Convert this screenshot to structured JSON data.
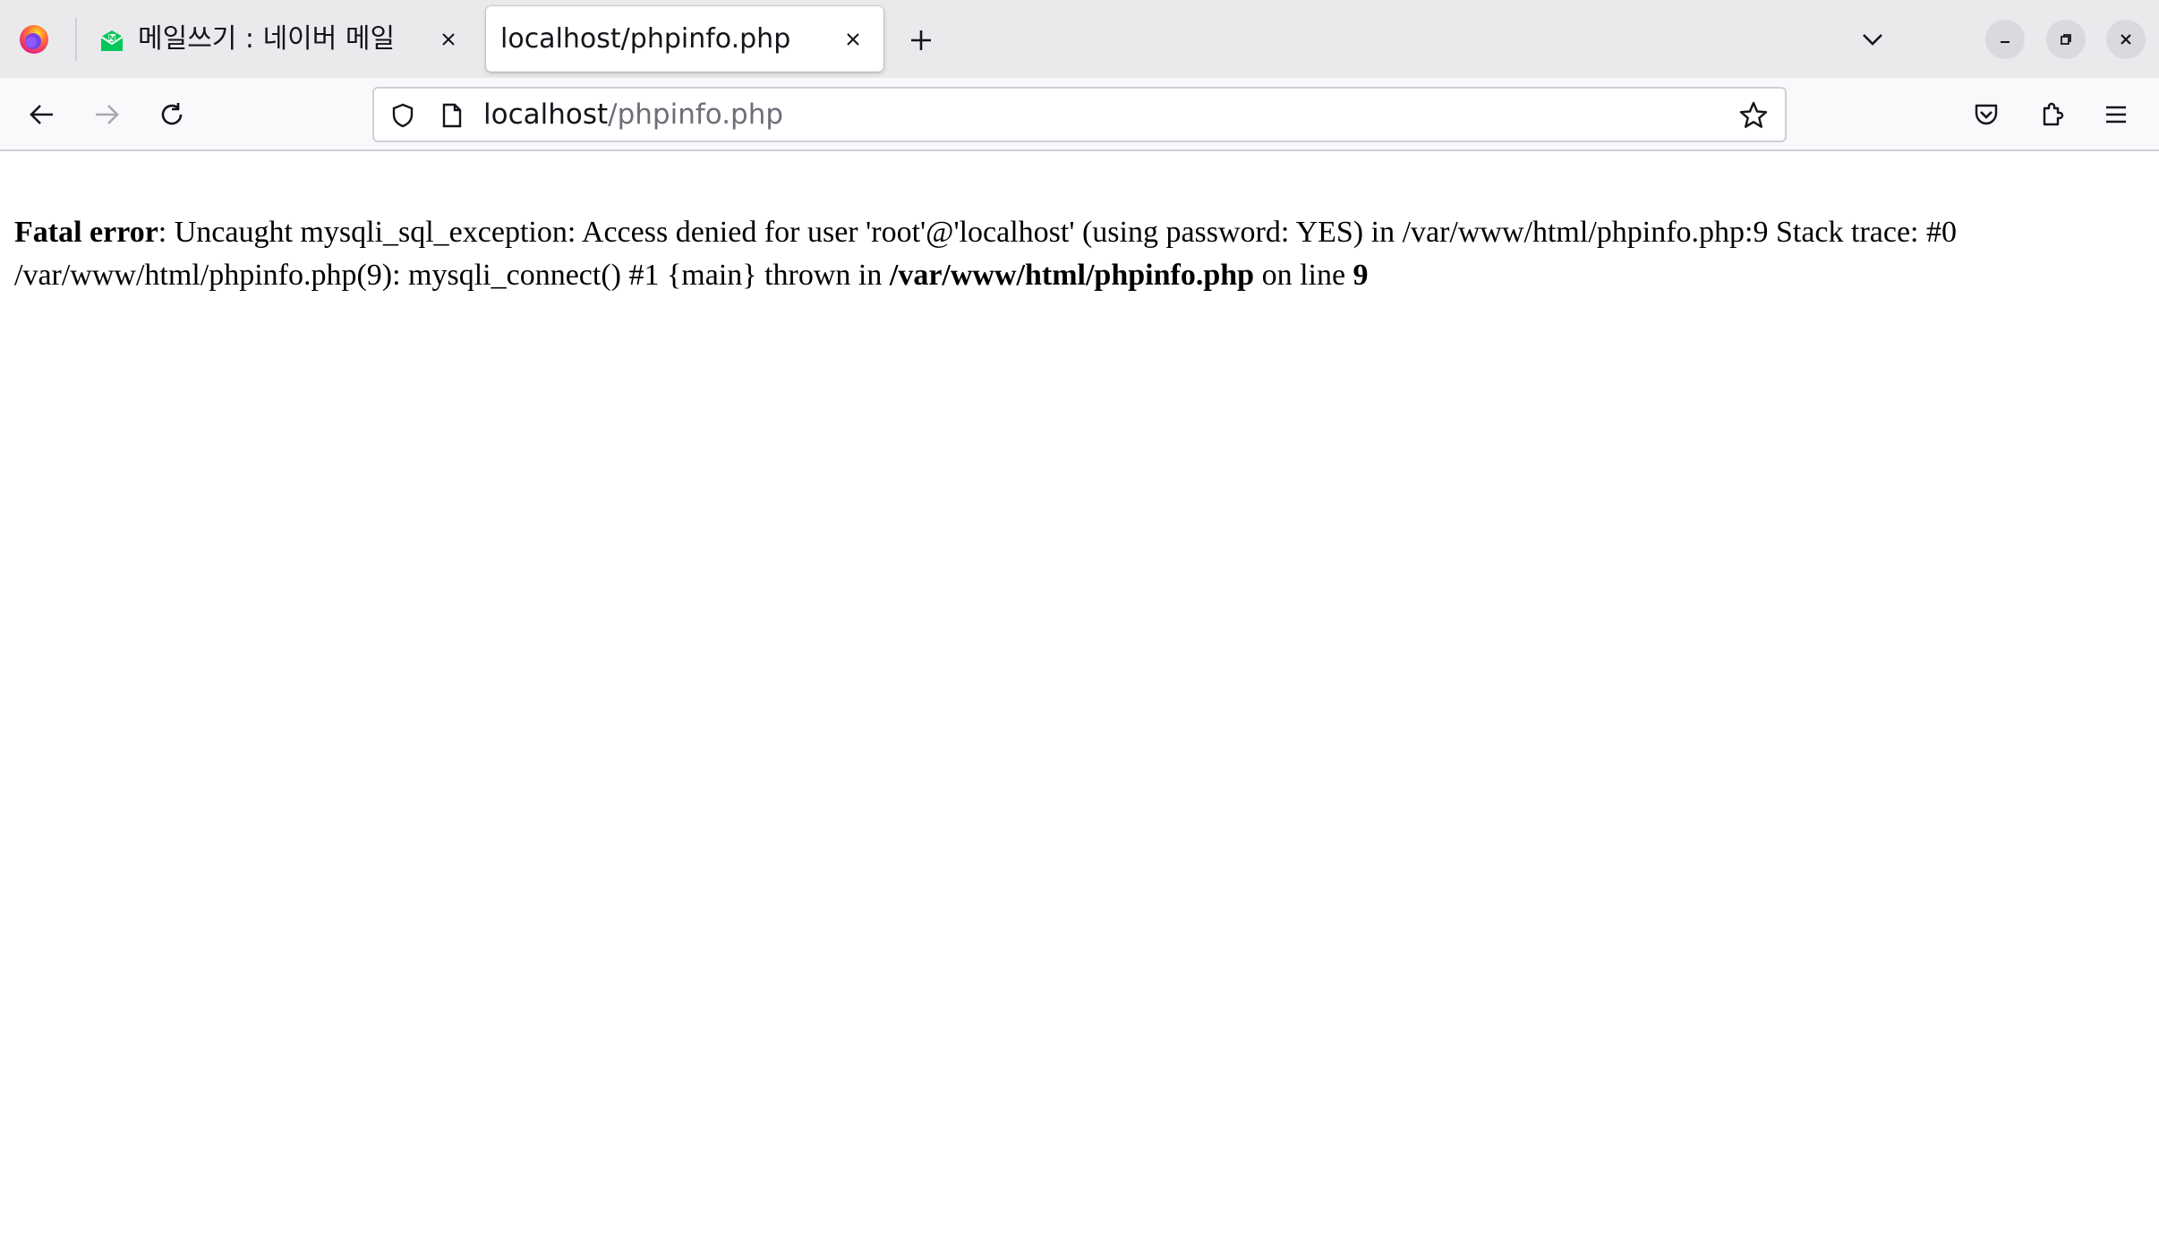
{
  "browser": {
    "tabs": [
      {
        "title": "메일쓰기 : 네이버 메일",
        "active": false,
        "favicon": "naver-mail-icon"
      },
      {
        "title": "localhost/phpinfo.php",
        "active": true,
        "favicon": "none"
      }
    ],
    "url": {
      "host": "localhost",
      "path": "/phpinfo.php"
    }
  },
  "content": {
    "error_label": "Fatal error",
    "error_message": ": Uncaught mysqli_sql_exception: Access denied for user 'root'@'localhost' (using password: YES) in /var/www/html/phpinfo.php:9 Stack trace: #0 /var/www/html/phpinfo.php(9): mysqli_connect() #1 {main} thrown in ",
    "error_file": "/var/www/html/phpinfo.php",
    "error_on_line": " on line ",
    "error_line": "9"
  },
  "colors": {
    "accent_naver": "#03c75a",
    "tabstrip_bg": "#eaeaed",
    "navbar_bg": "#f9f9fb"
  }
}
